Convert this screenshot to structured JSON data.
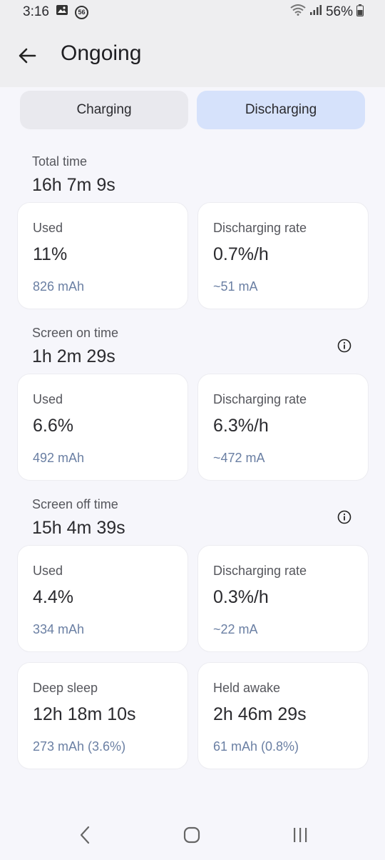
{
  "status": {
    "time": "3:16",
    "notif_badge": "56",
    "battery": "56%"
  },
  "app_bar": {
    "title": "Ongoing"
  },
  "toggle": {
    "charging_label": "Charging",
    "discharging_label": "Discharging",
    "selected": "Discharging"
  },
  "total": {
    "label": "Total time",
    "value": "16h 7m 9s",
    "used_label": "Used",
    "used_value": "11%",
    "used_sub": "826 mAh",
    "rate_label": "Discharging rate",
    "rate_value": "0.7%/h",
    "rate_sub": "~51 mA"
  },
  "screen_on": {
    "label": "Screen on time",
    "value": "1h 2m 29s",
    "used_label": "Used",
    "used_value": "6.6%",
    "used_sub": "492 mAh",
    "rate_label": "Discharging rate",
    "rate_value": "6.3%/h",
    "rate_sub": "~472 mA"
  },
  "screen_off": {
    "label": "Screen off time",
    "value": "15h 4m 39s",
    "used_label": "Used",
    "used_value": "4.4%",
    "used_sub": "334 mAh",
    "rate_label": "Discharging rate",
    "rate_value": "0.3%/h",
    "rate_sub": "~22 mA"
  },
  "sleep": {
    "deep_label": "Deep sleep",
    "deep_value": "12h 18m 10s",
    "deep_sub": "273 mAh (3.6%)",
    "awake_label": "Held awake",
    "awake_value": "2h 46m 29s",
    "awake_sub": "61 mAh (0.8%)"
  },
  "colors": {
    "accent_selected": "#d6e2fb",
    "sub_text": "#6a7fa3"
  },
  "icons": [
    "back-arrow-icon",
    "info-icon",
    "nav-back-icon",
    "nav-home-icon",
    "nav-recents-icon",
    "wifi-icon",
    "signal-icon",
    "battery-icon",
    "gallery-icon"
  ]
}
